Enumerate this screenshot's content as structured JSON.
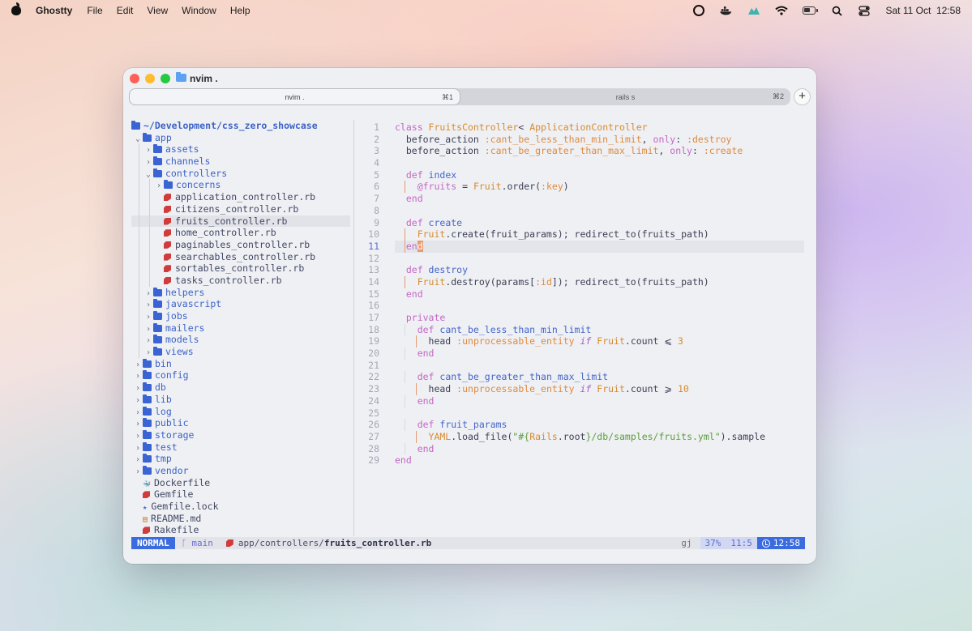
{
  "menubar": {
    "app_name": "Ghostty",
    "items": [
      "File",
      "Edit",
      "View",
      "Window",
      "Help"
    ],
    "datetime": "Sat 11 Oct  12:58"
  },
  "window": {
    "title": "nvim .",
    "tabs": [
      {
        "label": "nvim .",
        "shortcut": "⌘1",
        "active": true
      },
      {
        "label": "rails s",
        "shortcut": "⌘2",
        "active": false
      }
    ],
    "new_tab": "+"
  },
  "tree": {
    "root": "~/Development/css_zero_showcase",
    "rows": [
      {
        "name": "app",
        "kind": "dir",
        "depth": 0,
        "open": true
      },
      {
        "name": "assets",
        "kind": "dir",
        "depth": 1
      },
      {
        "name": "channels",
        "kind": "dir",
        "depth": 1
      },
      {
        "name": "controllers",
        "kind": "dir",
        "depth": 1,
        "open": true
      },
      {
        "name": "concerns",
        "kind": "dir",
        "depth": 2
      },
      {
        "name": "application_controller.rb",
        "kind": "rb",
        "depth": 2
      },
      {
        "name": "citizens_controller.rb",
        "kind": "rb",
        "depth": 2
      },
      {
        "name": "fruits_controller.rb",
        "kind": "rb",
        "depth": 2,
        "selected": true
      },
      {
        "name": "home_controller.rb",
        "kind": "rb",
        "depth": 2
      },
      {
        "name": "paginables_controller.rb",
        "kind": "rb",
        "depth": 2
      },
      {
        "name": "searchables_controller.rb",
        "kind": "rb",
        "depth": 2
      },
      {
        "name": "sortables_controller.rb",
        "kind": "rb",
        "depth": 2
      },
      {
        "name": "tasks_controller.rb",
        "kind": "rb",
        "depth": 2
      },
      {
        "name": "helpers",
        "kind": "dir",
        "depth": 1
      },
      {
        "name": "javascript",
        "kind": "dir",
        "depth": 1
      },
      {
        "name": "jobs",
        "kind": "dir",
        "depth": 1
      },
      {
        "name": "mailers",
        "kind": "dir",
        "depth": 1
      },
      {
        "name": "models",
        "kind": "dir",
        "depth": 1
      },
      {
        "name": "views",
        "kind": "dir",
        "depth": 1
      },
      {
        "name": "bin",
        "kind": "dir",
        "depth": 0
      },
      {
        "name": "config",
        "kind": "dir",
        "depth": 0
      },
      {
        "name": "db",
        "kind": "dir",
        "depth": 0
      },
      {
        "name": "lib",
        "kind": "dir",
        "depth": 0
      },
      {
        "name": "log",
        "kind": "dir",
        "depth": 0
      },
      {
        "name": "public",
        "kind": "dir",
        "depth": 0
      },
      {
        "name": "storage",
        "kind": "dir",
        "depth": 0
      },
      {
        "name": "test",
        "kind": "dir",
        "depth": 0
      },
      {
        "name": "tmp",
        "kind": "dir",
        "depth": 0
      },
      {
        "name": "vendor",
        "kind": "dir",
        "depth": 0
      },
      {
        "name": "Dockerfile",
        "kind": "docker",
        "depth": 0
      },
      {
        "name": "Gemfile",
        "kind": "rb",
        "depth": 0
      },
      {
        "name": "Gemfile.lock",
        "kind": "lock",
        "depth": 0
      },
      {
        "name": "README.md",
        "kind": "md",
        "depth": 0
      },
      {
        "name": "Rakefile",
        "kind": "rb",
        "depth": 0
      }
    ]
  },
  "editor": {
    "current_line": 11,
    "lines": [
      [
        [
          "kw",
          "class "
        ],
        [
          "cls",
          "FruitsController"
        ],
        [
          "",
          "< "
        ],
        [
          "cls",
          "ApplicationController"
        ]
      ],
      [
        [
          "",
          "  before_action "
        ],
        [
          "sym",
          ":cant_be_less_than_min_limit"
        ],
        [
          "",
          ", "
        ],
        [
          "kw",
          "only"
        ],
        [
          "",
          ": "
        ],
        [
          "sym",
          ":destroy"
        ]
      ],
      [
        [
          "",
          "  before_action "
        ],
        [
          "sym",
          ":cant_be_greater_than_max_limit"
        ],
        [
          "",
          ", "
        ],
        [
          "kw",
          "only"
        ],
        [
          "",
          ": "
        ],
        [
          "sym",
          ":create"
        ]
      ],
      [],
      [
        [
          "kw",
          "  def "
        ],
        [
          "fn",
          "index"
        ]
      ],
      [
        [
          "ivar",
          "    @fruits"
        ],
        [
          "",
          " = "
        ],
        [
          "cls",
          "Fruit"
        ],
        [
          "",
          ".order("
        ],
        [
          "sym",
          ":key"
        ],
        [
          "",
          ")"
        ]
      ],
      [
        [
          "kw",
          "  end"
        ]
      ],
      [],
      [
        [
          "kw",
          "  def "
        ],
        [
          "fn",
          "create"
        ]
      ],
      [
        [
          "cls",
          "    Fruit"
        ],
        [
          "",
          ".create(fruit_params); redirect_to(fruits_path)"
        ]
      ],
      [
        [
          "kw",
          "  en"
        ],
        [
          "cursor",
          "d"
        ]
      ],
      [],
      [
        [
          "kw",
          "  def "
        ],
        [
          "fn",
          "destroy"
        ]
      ],
      [
        [
          "cls",
          "    Fruit"
        ],
        [
          "",
          ".destroy(params["
        ],
        [
          "sym",
          ":id"
        ],
        [
          "",
          "]); redirect_to(fruits_path)"
        ]
      ],
      [
        [
          "kw",
          "  end"
        ]
      ],
      [],
      [
        [
          "kw",
          "  private"
        ]
      ],
      [
        [
          "kw",
          "    def "
        ],
        [
          "fn",
          "cant_be_less_than_min_limit"
        ]
      ],
      [
        [
          "",
          "      head "
        ],
        [
          "sym",
          ":unprocessable_entity "
        ],
        [
          "it",
          "if "
        ],
        [
          "cls",
          "Fruit"
        ],
        [
          "",
          ".count ⩽ "
        ],
        [
          "num",
          "3"
        ]
      ],
      [
        [
          "kw",
          "    end"
        ]
      ],
      [],
      [
        [
          "kw",
          "    def "
        ],
        [
          "fn",
          "cant_be_greater_than_max_limit"
        ]
      ],
      [
        [
          "",
          "      head "
        ],
        [
          "sym",
          ":unprocessable_entity "
        ],
        [
          "it",
          "if "
        ],
        [
          "cls",
          "Fruit"
        ],
        [
          "",
          ".count ⩾ "
        ],
        [
          "num",
          "10"
        ]
      ],
      [
        [
          "kw",
          "    end"
        ]
      ],
      [],
      [
        [
          "kw",
          "    def "
        ],
        [
          "fn",
          "fruit_params"
        ]
      ],
      [
        [
          "cls",
          "      YAML"
        ],
        [
          "",
          ".load_file("
        ],
        [
          "str",
          "\"#{"
        ],
        [
          "cls",
          "Rails"
        ],
        [
          "",
          ".root"
        ],
        [
          "str",
          "}/db/samples/fruits.yml\""
        ],
        [
          "",
          ").sample"
        ]
      ],
      [
        [
          "kw",
          "    end"
        ]
      ],
      [
        [
          "kw",
          "end"
        ]
      ]
    ]
  },
  "statusline": {
    "mode": "NORMAL",
    "branch": "main",
    "path_dir": "app/controllers/",
    "path_file": "fruits_controller.rb",
    "keys": "gj",
    "percent": "37%",
    "position": "11:5",
    "time": "12:58"
  },
  "colors": {
    "accent": "#3a6bdf",
    "keyword": "#c467c4",
    "constant": "#d68b30",
    "function": "#4465c8",
    "string": "#5c9d3a"
  }
}
